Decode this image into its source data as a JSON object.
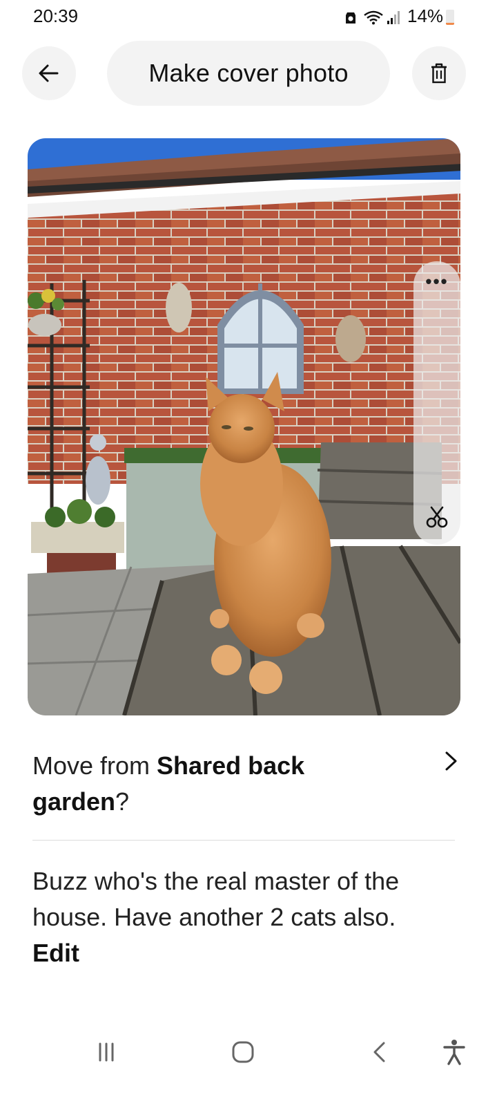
{
  "status_bar": {
    "time": "20:39",
    "battery_text": "14%",
    "battery_level": 0.14,
    "icons": [
      "app-notification-icon",
      "wifi-icon",
      "signal-icon",
      "battery-icon"
    ]
  },
  "header": {
    "title": "Make cover photo",
    "back_icon": "arrow-left-icon",
    "delete_icon": "trash-icon"
  },
  "photo": {
    "subject": "cat-photo",
    "overflow_label": "•••",
    "edit_icon": "scissors-icon"
  },
  "move_row": {
    "prefix": "Move from ",
    "location": "Shared back garden",
    "suffix": "?",
    "chevron_icon": "chevron-right-icon"
  },
  "caption": {
    "text": "Buzz who's the real master of the house. Have another 2 cats also.",
    "edit_label": "Edit"
  },
  "nav_bar": {
    "icons": [
      "recent-apps-icon",
      "home-icon",
      "back-icon",
      "accessibility-icon"
    ]
  },
  "colors": {
    "pill_bg": "#f3f3f3",
    "text": "#222222",
    "brick": "#b5523b",
    "sky": "#2f6fd4",
    "battery_low": "#f08a4b"
  }
}
